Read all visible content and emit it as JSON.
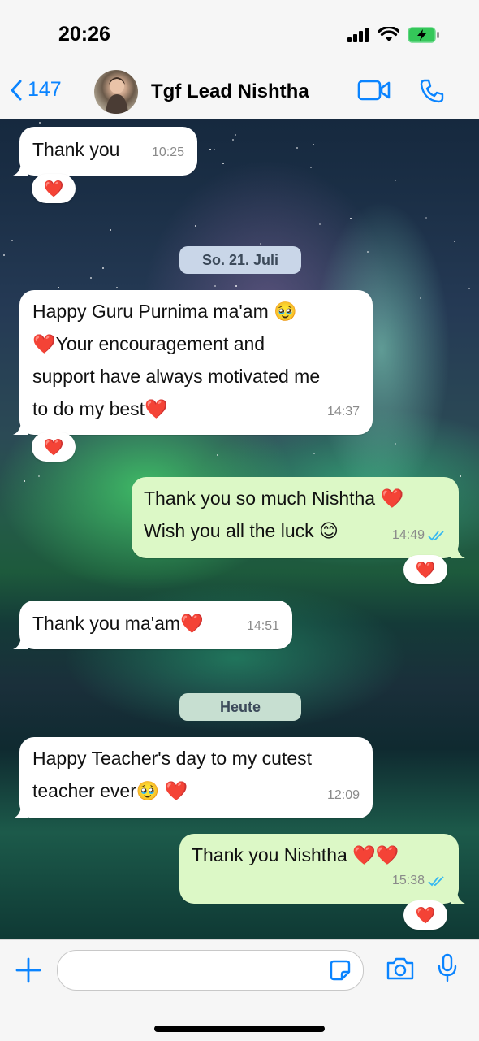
{
  "status": {
    "time": "20:26"
  },
  "header": {
    "back_count": "147",
    "contact_name": "Tgf Lead Nishtha"
  },
  "messages": [
    {
      "text": "Thank you",
      "time": "10:25",
      "reaction": "❤️"
    },
    {
      "text": "Happy Guru Purnima ma'am 🥹 ❤️Your encouragement and support have always motivated me to do my best❤️",
      "lines": [
        "Happy Guru Purnima ma'am 🥹",
        "❤️Your encouragement and",
        "support have always motivated me",
        "to do my best❤️"
      ],
      "time": "14:37",
      "reaction": "❤️"
    },
    {
      "lines": [
        "Thank you so much Nishtha ❤️",
        "Wish you all the luck 😊"
      ],
      "time": "14:49",
      "reaction": "❤️"
    },
    {
      "text": "Thank you ma'am❤️",
      "time": "14:51"
    },
    {
      "lines": [
        "Happy Teacher's day to my cutest",
        "teacher ever🥹 ❤️"
      ],
      "time": "12:09"
    },
    {
      "text": "Thank you Nishtha ❤️❤️",
      "time": "15:38",
      "reaction": "❤️"
    }
  ],
  "dates": {
    "first": "So. 21. Juli",
    "second": "Heute"
  },
  "colors": {
    "accent": "#0a84ff",
    "outgoing": "#dcf8c6",
    "incoming": "#ffffff",
    "read_tick": "#34b7f1"
  }
}
